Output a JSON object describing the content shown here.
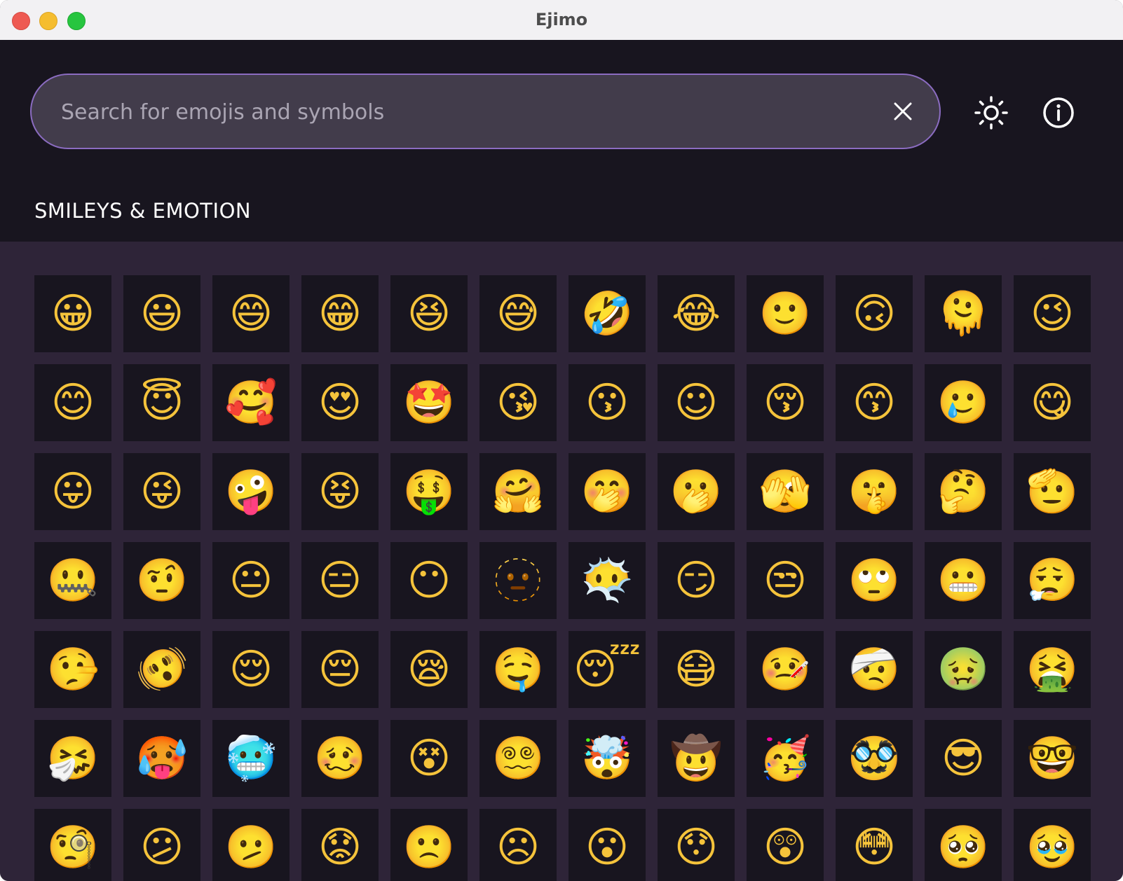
{
  "window": {
    "title": "Ejimo"
  },
  "search": {
    "placeholder": "Search for emojis and symbols",
    "value": "",
    "clear_icon": "close-icon"
  },
  "toolbar": {
    "theme_icon": "sun-icon",
    "info_icon": "info-icon"
  },
  "category": {
    "title": "SMILEYS & EMOTION"
  },
  "emojis": [
    "😀",
    "😃",
    "😄",
    "😁",
    "😆",
    "😅",
    "🤣",
    "😂",
    "🙂",
    "🙃",
    "🫠",
    "😉",
    "😊",
    "😇",
    "🥰",
    "😍",
    "🤩",
    "😘",
    "😗",
    "☺",
    "😚",
    "😙",
    "🥲",
    "😋",
    "😛",
    "😜",
    "🤪",
    "😝",
    "🤑",
    "🤗",
    "🤭",
    "🫢",
    "🫣",
    "🤫",
    "🤔",
    "🫡",
    "🤐",
    "🤨",
    "😐",
    "😑",
    "😶",
    "🫥",
    "😶‍🌫️",
    "😏",
    "😒",
    "🙄",
    "😬",
    "😮‍💨",
    "🤥",
    "🫨",
    "😌",
    "😔",
    "😪",
    "🤤",
    "😴",
    "😷",
    "🤒",
    "🤕",
    "🤢",
    "🤮",
    "🤧",
    "🥵",
    "🥶",
    "🥴",
    "😵",
    "😵‍💫",
    "🤯",
    "🤠",
    "🥳",
    "🥸",
    "😎",
    "🤓",
    "🧐",
    "😕",
    "🫤",
    "😟",
    "🙁",
    "☹",
    "😮",
    "😯",
    "😲",
    "😳",
    "🥺",
    "🥹"
  ]
}
